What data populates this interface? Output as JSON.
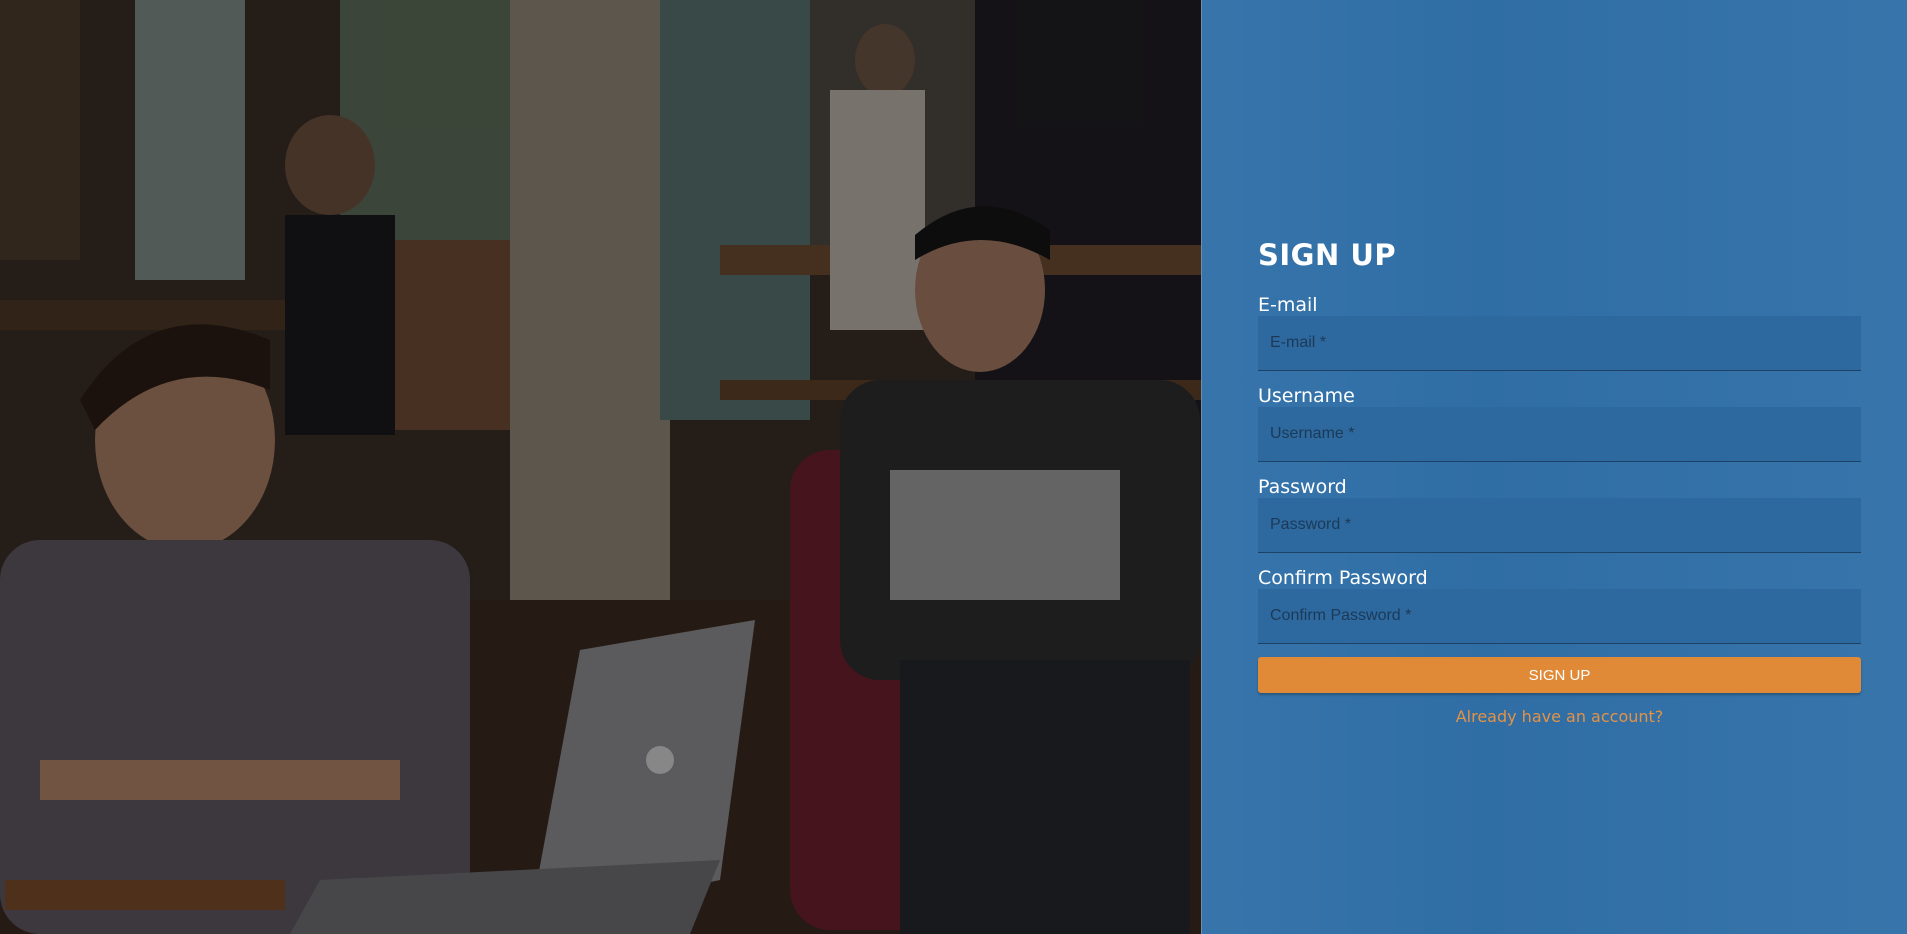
{
  "background_image": {
    "description_icon": "photo-people-coworking"
  },
  "form": {
    "title": "SIGN UP",
    "fields": [
      {
        "label": "E-mail",
        "placeholder": "E-mail *",
        "value": ""
      },
      {
        "label": "Username",
        "placeholder": "Username *",
        "value": ""
      },
      {
        "label": "Password",
        "placeholder": "Password *",
        "value": ""
      },
      {
        "label": "Confirm Password",
        "placeholder": "Confirm Password *",
        "value": ""
      }
    ],
    "submit_label": "SIGN UP",
    "login_link_label": "Already have an account?"
  },
  "colors": {
    "panel_bg": "#3070a8",
    "button_bg": "#e08a38",
    "link": "#e39246"
  }
}
